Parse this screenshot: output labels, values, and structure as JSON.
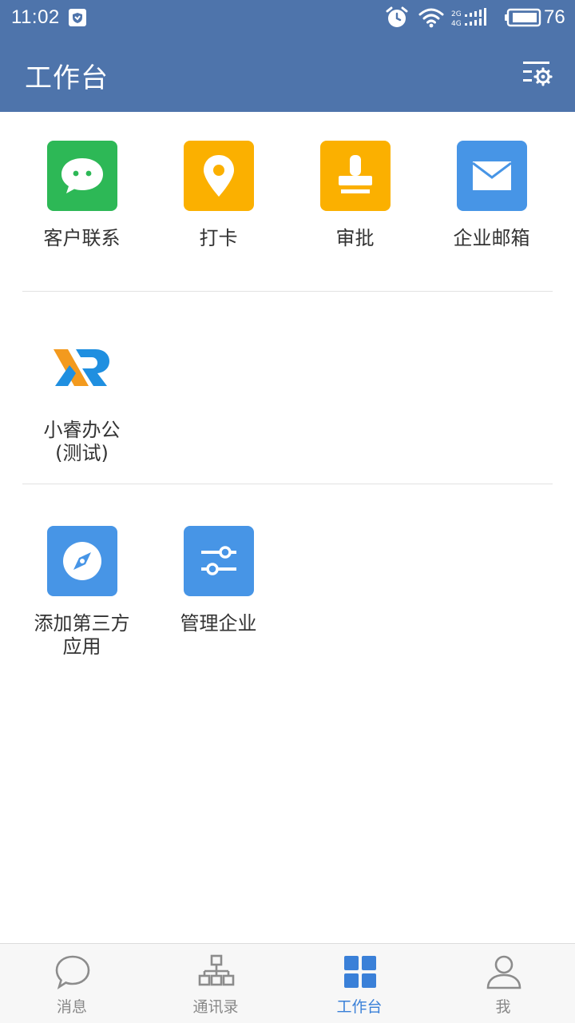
{
  "status_bar": {
    "time": "11:02",
    "network": "2G 4G",
    "battery": "76"
  },
  "header": {
    "title": "工作台"
  },
  "apps": {
    "row1": [
      {
        "label": "客户联系",
        "icon": "chat-bubble-icon",
        "color": "#2db856"
      },
      {
        "label": "打卡",
        "icon": "location-pin-icon",
        "color": "#fbb000"
      },
      {
        "label": "审批",
        "icon": "stamp-icon",
        "color": "#fbb000"
      },
      {
        "label": "企业邮箱",
        "icon": "mail-icon",
        "color": "#4795e6"
      }
    ],
    "row2": [
      {
        "label_line1": "小睿办公",
        "label_line2": "(测试)",
        "icon": "xr-logo-icon"
      }
    ],
    "row3": [
      {
        "label_line1": "添加第三方",
        "label_line2": "应用",
        "icon": "compass-icon",
        "color": "#4795e6"
      },
      {
        "label": "管理企业",
        "icon": "sliders-icon",
        "color": "#4795e6"
      }
    ]
  },
  "bottom_nav": [
    {
      "label": "消息",
      "icon": "message-icon",
      "active": false
    },
    {
      "label": "通讯录",
      "icon": "org-chart-icon",
      "active": false
    },
    {
      "label": "工作台",
      "icon": "grid-icon",
      "active": true
    },
    {
      "label": "我",
      "icon": "person-icon",
      "active": false
    }
  ],
  "colors": {
    "header": "#4e74ab",
    "active_tab": "#3a80d8",
    "inactive_tab": "#888888"
  }
}
